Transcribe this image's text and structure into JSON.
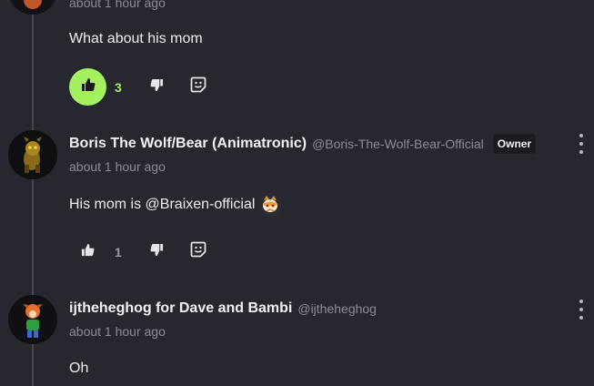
{
  "comments": [
    {
      "time": "about 1 hour ago",
      "body": "What about his mom",
      "likes": "3",
      "liked": true
    },
    {
      "author": "Boris The Wolf/Bear (Animatronic)",
      "handle": "@Boris-The-Wolf-Bear-Official",
      "badge": "Owner",
      "time": "about 1 hour ago",
      "body": "His mom is @Braixen-official",
      "likes": "1",
      "liked": false
    },
    {
      "author": "ijtheheghog for Dave and Bambi",
      "handle": "@ijtheheghog",
      "time": "about 1 hour ago",
      "body": "Oh"
    }
  ],
  "icons": {
    "like": "thumbs-up-icon",
    "dislike": "thumbs-down-icon",
    "react": "emoji-sticker-icon",
    "menu": "kebab-menu-icon"
  },
  "colors": {
    "background": "#27272f",
    "accent": "#a5f05e",
    "muted": "#8c8c97"
  }
}
